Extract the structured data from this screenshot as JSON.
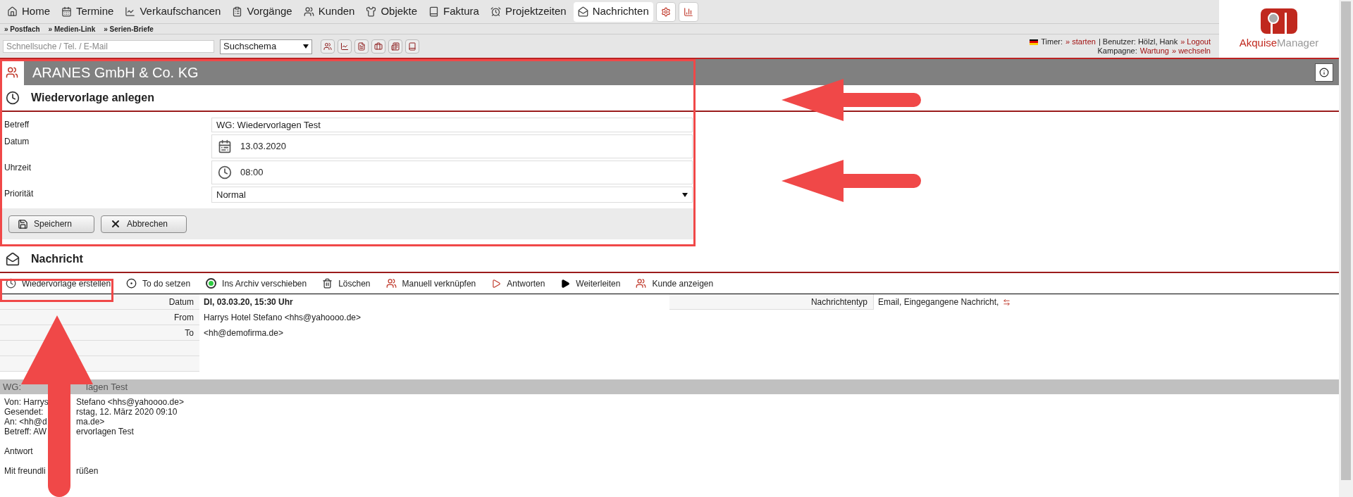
{
  "nav": {
    "tabs": [
      {
        "kind": "home",
        "label": "Home",
        "selected": false
      },
      {
        "kind": "calendar",
        "label": "Termine",
        "selected": false
      },
      {
        "kind": "chart",
        "label": "Verkaufschancen",
        "selected": false
      },
      {
        "kind": "clipboard",
        "label": "Vorgänge",
        "selected": false
      },
      {
        "kind": "users",
        "label": "Kunden",
        "selected": false
      },
      {
        "kind": "objects",
        "label": "Objekte",
        "selected": false
      },
      {
        "kind": "book",
        "label": "Faktura",
        "selected": false
      },
      {
        "kind": "clock",
        "label": "Projektzeiten",
        "selected": false
      },
      {
        "kind": "mail",
        "label": "Nachrichten",
        "selected": true
      }
    ]
  },
  "submenu": [
    "» Postfach",
    "» Medien-Link",
    "» Serien-Briefe"
  ],
  "search": {
    "placeholder": "Schnellsuche / Tel. / E-Mail"
  },
  "schema_select": {
    "value": "Suchschema"
  },
  "status_lines": [
    [
      {
        "kind": "text",
        "text": "Timer:"
      },
      {
        "kind": "link",
        "text": "» starten"
      },
      {
        "kind": "text",
        "text": "| Benutzer: Hölzl, Hank"
      },
      {
        "kind": "link",
        "text": "» Logout"
      }
    ],
    [
      {
        "kind": "text",
        "text": "Kampagne:"
      },
      {
        "kind": "link",
        "text": "Wartung"
      },
      {
        "kind": "link",
        "text": "» wechseln"
      }
    ]
  ],
  "logo": {
    "word_1": "Akquise",
    "word_2": "Manager"
  },
  "company": {
    "name": "ARANES GmbH & Co. KG"
  },
  "followup_form": {
    "title": "Wiedervorlage anlegen",
    "fields": [
      {
        "kind": "text",
        "label": "Betreff",
        "value": "WG: Wiedervorlagen Test"
      },
      {
        "kind": "date",
        "label": "Datum",
        "value": "13.03.2020"
      },
      {
        "kind": "time",
        "label": "Uhrzeit",
        "value": "08:00"
      },
      {
        "kind": "select",
        "label": "Priorität",
        "value": "Normal"
      }
    ],
    "buttons": [
      {
        "kind": "save",
        "label": "Speichern"
      },
      {
        "kind": "cancel",
        "label": "Abbrechen"
      }
    ]
  },
  "message": {
    "title": "Nachricht",
    "actions": [
      {
        "kind": "followup",
        "label": "Wiedervorlage erstellen"
      },
      {
        "kind": "todo",
        "label": "To do setzen"
      },
      {
        "kind": "archive",
        "label": "Ins Archiv verschieben"
      },
      {
        "kind": "delete",
        "label": "Löschen"
      },
      {
        "kind": "link",
        "label": "Manuell verknüpfen"
      },
      {
        "kind": "reply",
        "label": "Antworten"
      },
      {
        "kind": "forward",
        "label": "Weiterleiten"
      },
      {
        "kind": "customer",
        "label": "Kunde anzeigen"
      }
    ],
    "headers_left": [
      {
        "label": "Datum",
        "value": "DI, 03.03.20, 15:30 Uhr",
        "bold": true
      },
      {
        "label": "From",
        "value": "Harrys Hotel Stefano <hhs@yahoooo.de>",
        "bold": false
      },
      {
        "label": "To",
        "value": "<hh@demofirma.de>",
        "bold": false
      }
    ],
    "headers_right": [
      {
        "label": "Nachrichtentyp",
        "value": "Email, Eingegangene Nachricht,"
      }
    ],
    "subject_parts": [
      "WG:",
      "lagen Test"
    ],
    "body": [
      [
        [
          "Von: Harrys",
          "Stefano <hhs@yahoooo.de>"
        ],
        [
          "Gesendet:",
          "rstag, 12. März 2020 09:10"
        ],
        [
          "An:  <hh@d",
          "ma.de>"
        ],
        [
          "Betreff: AW",
          "ervorlagen Test"
        ]
      ],
      [
        [
          "Antwort"
        ]
      ],
      [
        [
          "Mit freundli",
          "rüßen"
        ]
      ]
    ]
  }
}
